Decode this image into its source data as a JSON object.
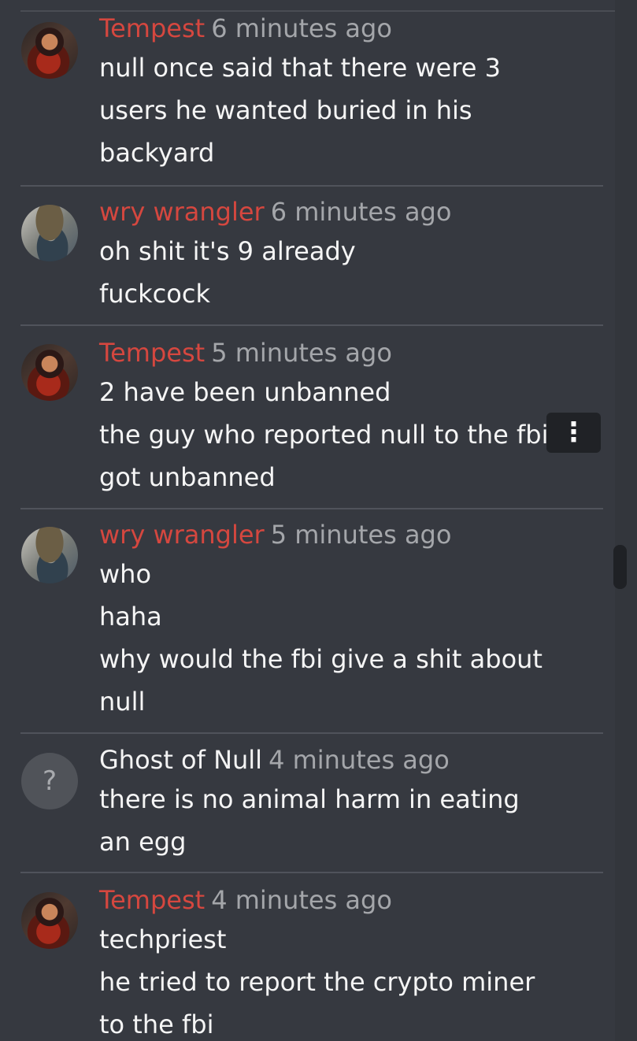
{
  "messages": [
    {
      "author": "Tempest",
      "time": "6 minutes ago",
      "avatar": "tempest-avatar",
      "lines": [
        "null once said that there were 3",
        "users he wanted buried in his",
        "backyard"
      ]
    },
    {
      "author": "wry wrangler",
      "time": "6 minutes ago",
      "avatar": "wry-wrangler-avatar",
      "lines": [
        "oh shit it's 9 already",
        "fuckcock"
      ]
    },
    {
      "author": "Tempest",
      "time": "5 minutes ago",
      "avatar": "tempest-avatar",
      "lines": [
        "2 have been unbanned",
        "the guy who reported null to the fbi",
        "got unbanned"
      ]
    },
    {
      "author": "wry wrangler",
      "time": "5 minutes ago",
      "avatar": "wry-wrangler-avatar",
      "lines": [
        "who",
        "haha",
        "why would the fbi give a shit about",
        "null"
      ]
    },
    {
      "author": "Ghost of Null",
      "time": "4 minutes ago",
      "avatar": "ghost-avatar",
      "avatar_glyph": "?",
      "lines": [
        "there is no animal harm in eating",
        "an egg"
      ]
    },
    {
      "author": "Tempest",
      "time": "4 minutes ago",
      "avatar": "tempest-avatar",
      "lines": [
        "techpriest",
        "he tried to report the crypto miner",
        "to the fbi"
      ]
    }
  ],
  "message_menu": {
    "glyph": "⋮",
    "icon": "more-vertical-icon"
  },
  "colors": {
    "background": "#363940",
    "author_red": "#d5473f",
    "timestamp": "#a4a6aa",
    "text": "#f5f5f5",
    "menu_bg": "#202226"
  }
}
